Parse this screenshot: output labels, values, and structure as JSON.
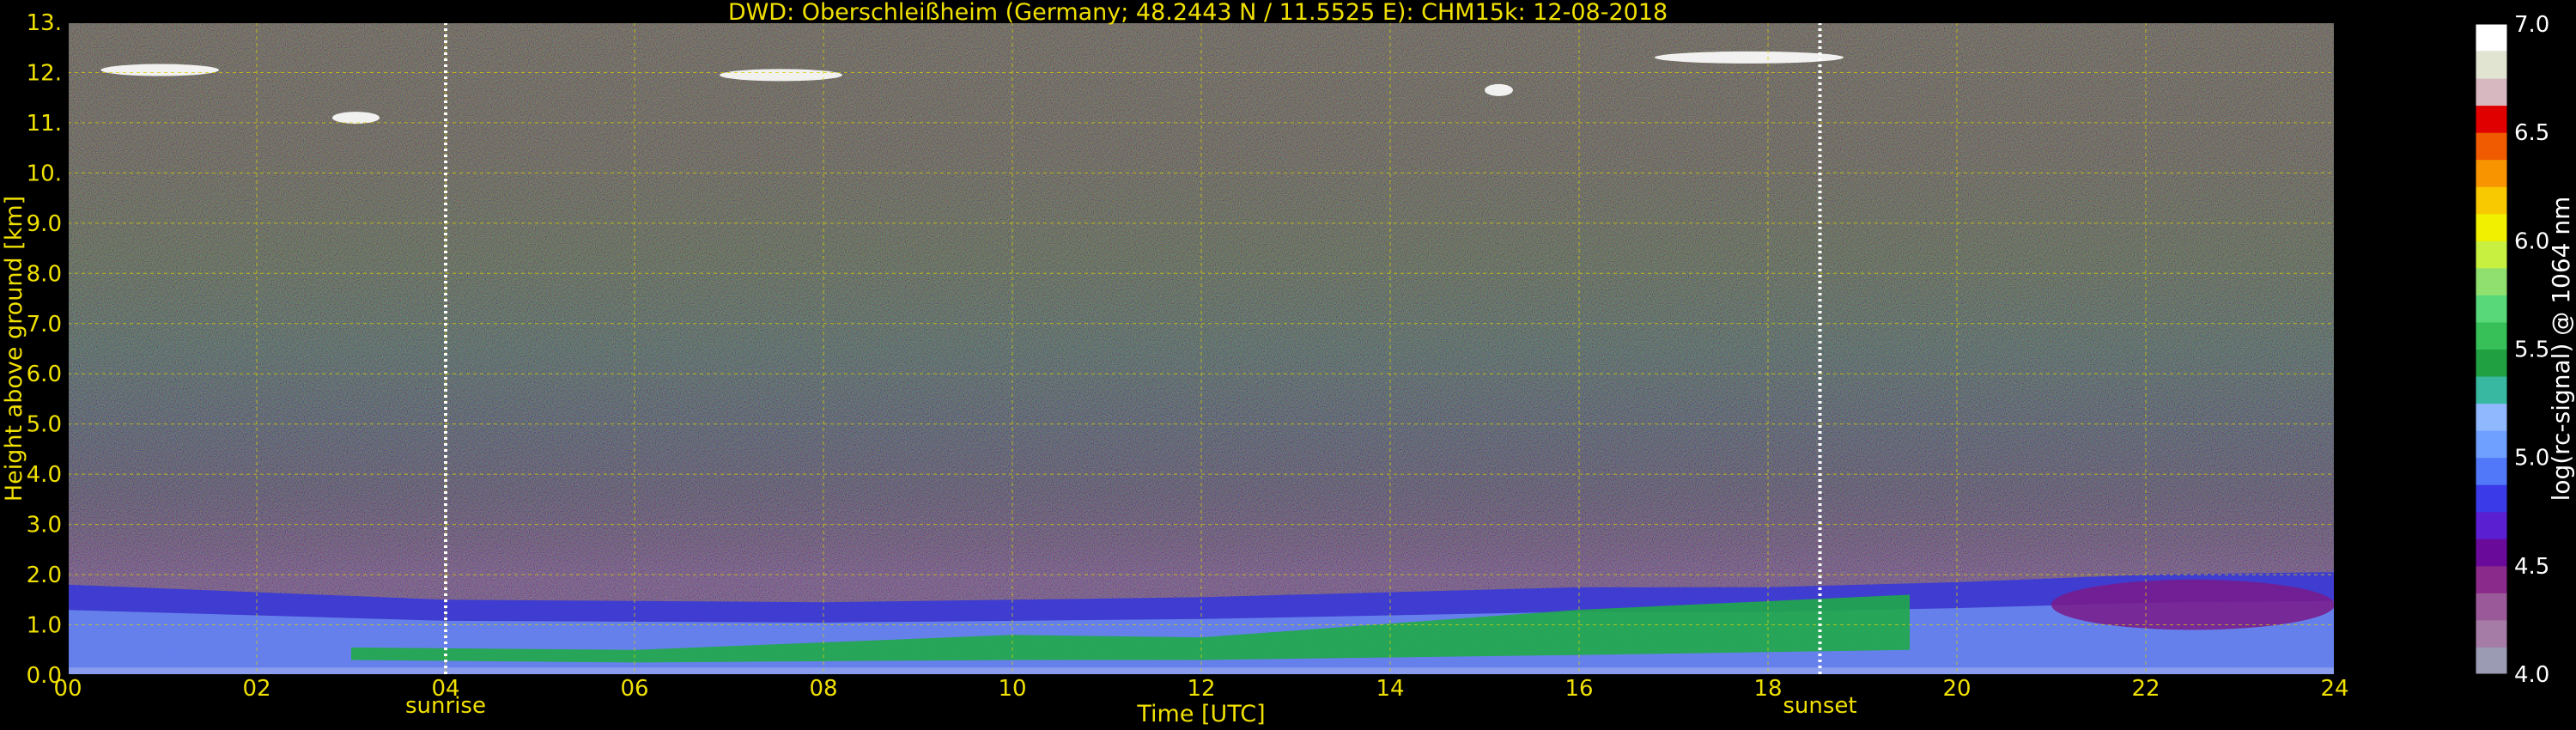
{
  "chart_data": {
    "type": "heatmap",
    "title": "DWD: Oberschleißheim (Germany; 48.2443 N / 11.5525 E):    CHM15k: 12-08-2018",
    "xlabel": "Time [UTC]",
    "ylabel": "Height above ground [km]",
    "xlim": [
      0,
      24
    ],
    "ylim": [
      0,
      13
    ],
    "x_ticks": [
      "00",
      "02",
      "04",
      "06",
      "08",
      "10",
      "12",
      "14",
      "16",
      "18",
      "20",
      "22",
      "24"
    ],
    "y_ticks": [
      "0.0",
      "1.0",
      "2.0",
      "3.0",
      "4.0",
      "5.0",
      "6.0",
      "7.0",
      "8.0",
      "9.0",
      "10.",
      "11.",
      "12.",
      "13."
    ],
    "grid": true,
    "events": [
      {
        "label": "sunrise",
        "time": 4.0
      },
      {
        "label": "sunset",
        "time": 18.55
      }
    ],
    "colorbar": {
      "label": "log(rc-signal) @ 1064 nm",
      "range": [
        4.0,
        7.0
      ],
      "ticks": [
        "4.0",
        "4.5",
        "5.0",
        "5.5",
        "6.0",
        "6.5",
        "7.0"
      ],
      "colors": [
        "#9b9bb4",
        "#a47ca6",
        "#9a5a9a",
        "#8a2a8a",
        "#6a0a9a",
        "#5a1fd0",
        "#3a3ae8",
        "#5078f8",
        "#70a0ff",
        "#90b8ff",
        "#38b8a0",
        "#20a040",
        "#38c058",
        "#58d878",
        "#90e070",
        "#c8f040",
        "#f0f000",
        "#f8c800",
        "#f89400",
        "#f05a00",
        "#e00000",
        "#d8b8c0",
        "#e0e4d0",
        "#ffffff"
      ]
    },
    "features": {
      "boundary_layer_top_km": [
        [
          0,
          1.8
        ],
        [
          4,
          1.5
        ],
        [
          8,
          1.45
        ],
        [
          12,
          1.55
        ],
        [
          16,
          1.75
        ],
        [
          18,
          1.75
        ],
        [
          20,
          1.85
        ],
        [
          22,
          2.0
        ],
        [
          24,
          2.05
        ]
      ],
      "green_aerosol_layer": [
        [
          3,
          0.3,
          0.55
        ],
        [
          6,
          0.25,
          0.5
        ],
        [
          10,
          0.3,
          0.8
        ],
        [
          12,
          0.3,
          0.75
        ],
        [
          16,
          0.4,
          1.3
        ],
        [
          19.5,
          0.5,
          1.6
        ]
      ],
      "magenta_patch": {
        "time": [
          21.0,
          24.0
        ],
        "height": [
          0.9,
          1.9
        ]
      },
      "cirrus_km": [
        {
          "t0": 0.35,
          "t1": 1.6,
          "h": 12.05
        },
        {
          "t0": 2.8,
          "t1": 3.3,
          "h": 11.1
        },
        {
          "t0": 6.9,
          "t1": 8.2,
          "h": 11.95
        },
        {
          "t0": 15.0,
          "t1": 15.3,
          "h": 11.65
        },
        {
          "t0": 16.8,
          "t1": 18.8,
          "h": 12.3
        }
      ]
    }
  }
}
